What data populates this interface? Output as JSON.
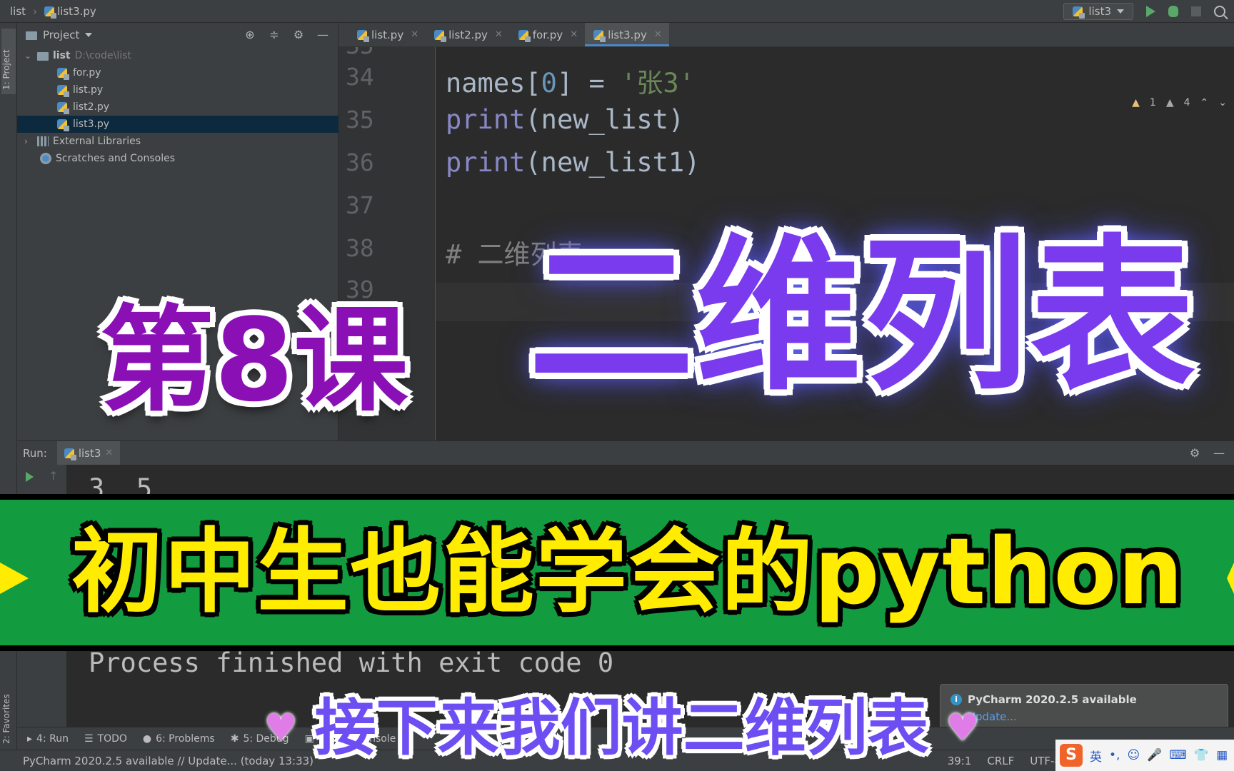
{
  "navbar": {
    "breadcrumb_project": "list",
    "breadcrumb_file": "list3.py",
    "run_config": "list3"
  },
  "left_strip": {
    "project_tab": "1: Project",
    "favorites_tab": "2: Favorites"
  },
  "project_panel": {
    "title": "Project",
    "tree": [
      {
        "label": "list",
        "path": "D:\\code\\list"
      },
      {
        "label": "for.py"
      },
      {
        "label": "list.py"
      },
      {
        "label": "list2.py"
      },
      {
        "label": "list3.py"
      },
      {
        "label": "External Libraries"
      },
      {
        "label": "Scratches and Consoles"
      }
    ]
  },
  "editor": {
    "tabs": [
      "list.py",
      "list2.py",
      "for.py",
      "list3.py"
    ],
    "active_tab": "list3.py",
    "inspections": {
      "warnings": "1",
      "weak_warnings": "4"
    },
    "lines": [
      {
        "num": "35",
        "partial": true
      },
      {
        "num": "34",
        "code": [
          "names[",
          "0",
          "] = ",
          "'张3'"
        ]
      },
      {
        "num": "35",
        "code": [
          "print",
          "(new_list)"
        ]
      },
      {
        "num": "36",
        "code": [
          "print",
          "(new_list1)"
        ]
      },
      {
        "num": "37",
        "code": [
          ""
        ]
      },
      {
        "num": "38",
        "code": [
          "# 二维列表"
        ]
      },
      {
        "num": "39",
        "code": [
          ""
        ]
      }
    ]
  },
  "run": {
    "label": "Run:",
    "tab": "list3",
    "output_top": "3  5",
    "output_bottom": "Process finished with exit code 0"
  },
  "tool_tabs": {
    "run": "4: Run",
    "todo": "TODO",
    "problems": "6: Problems",
    "debug": "5: Debug",
    "python": "Python Console"
  },
  "status": {
    "message": "PyCharm 2020.2.5 available // Update... (today 13:33)",
    "position": "39:1",
    "line_sep": "CRLF",
    "encoding": "UTF-8"
  },
  "notification": {
    "title": "PyCharm 2020.2.5 available",
    "link": "Update..."
  },
  "overlay": {
    "lesson_number": "第8课",
    "lesson_title": "二维列表",
    "banner": "初中生也能学会的python",
    "subtitle": "接下来我们讲二维列表"
  },
  "ime": {
    "lang": "英"
  },
  "colors": {
    "lesson_number": "#8a10b6",
    "lesson_title": "#7a3bee",
    "banner_bg": "#139c3f",
    "banner_text": "#ffec00",
    "subtitle": "#6d4ef2"
  }
}
